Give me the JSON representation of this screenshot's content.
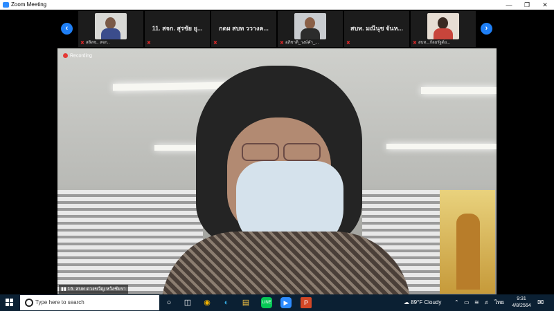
{
  "window": {
    "title": "Zoom Meeting"
  },
  "thumbnails": [
    {
      "display_name": "",
      "label": "สลิลช.. สจก.."
    },
    {
      "display_name": "11. สจก. สุรชัย ยุ...",
      "label": ""
    },
    {
      "display_name": "กดผ สบท ววางค...",
      "label": ""
    },
    {
      "display_name": "",
      "label": "อภิชาติ_วงษ์คำ_..."
    },
    {
      "display_name": "สบท. มณีนุช จันห...",
      "label": ""
    },
    {
      "display_name": "",
      "label": "สบท...กัลยรัฐต์ย..."
    }
  ],
  "main_video": {
    "recording_label": "Recording",
    "speaker_label": "16. สบท ดวงขวัญ หวังชัยรา"
  },
  "taskbar": {
    "search_placeholder": "Type here to search",
    "weather": "89°F  Cloudy",
    "language": "ไทย",
    "time": "9:31",
    "date": "4/8/2564"
  }
}
